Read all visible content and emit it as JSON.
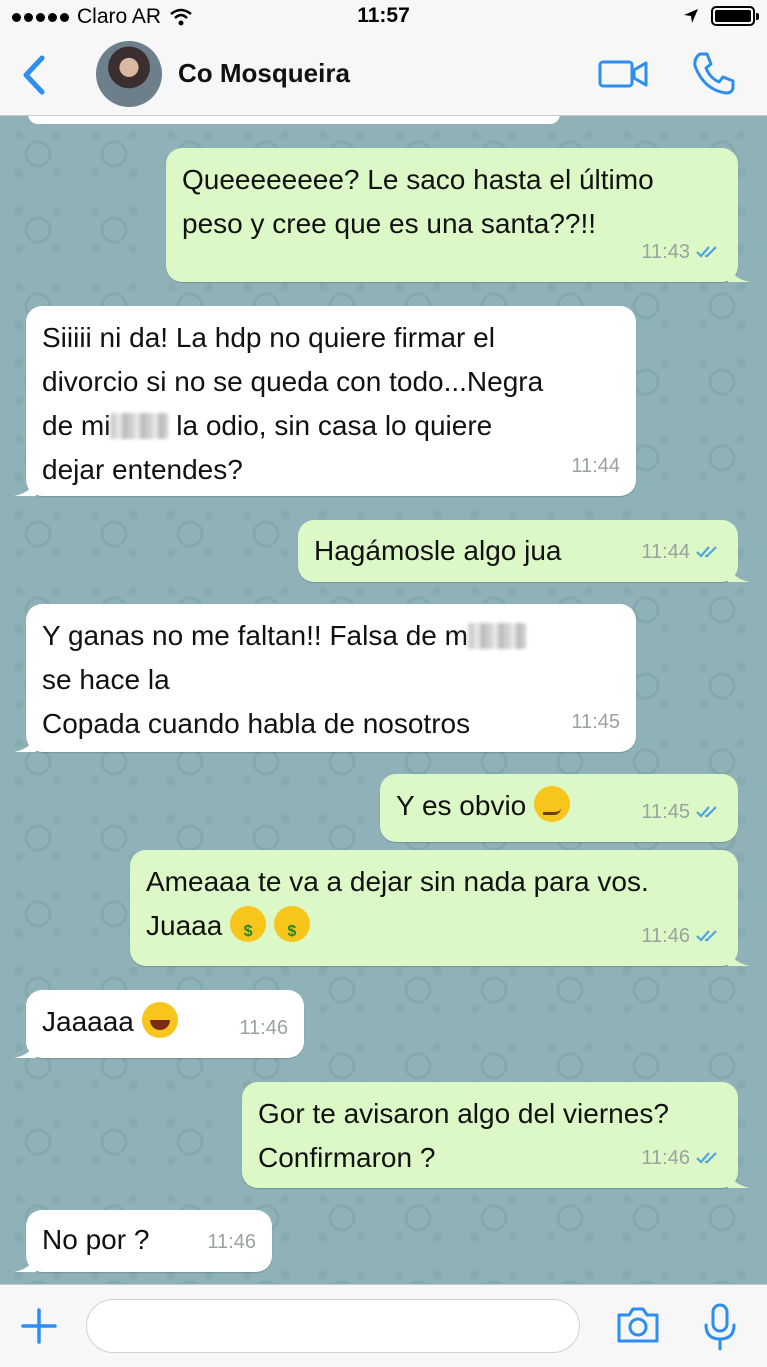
{
  "status_bar": {
    "carrier": "Claro AR",
    "time": "11:57"
  },
  "header": {
    "contact_name": "Co Mosqueira",
    "back_icon": "chevron-left-icon",
    "video_icon": "video-camera-icon",
    "call_icon": "phone-icon"
  },
  "colors": {
    "accent": "#2b8ef0",
    "outgoing_bubble": "#dcf8c6",
    "incoming_bubble": "#ffffff",
    "read_ticks": "#4fa3e0"
  },
  "messages": [
    {
      "direction": "out",
      "text_parts": [
        "Queeeeeeee? Le saco hasta el último",
        "peso y cree que es una santa??!!"
      ],
      "time": "11:43",
      "read": true
    },
    {
      "direction": "in",
      "text_parts": [
        "Siiiii ni da! La hdp no quiere firmar el",
        "divorcio si no se queda con todo...Negra",
        "de mi",
        "la odio, sin casa lo quiere",
        "dejar entendes?"
      ],
      "time": "11:44"
    },
    {
      "direction": "out",
      "text_parts": [
        "Hagámosle algo jua"
      ],
      "time": "11:44",
      "read": true
    },
    {
      "direction": "in",
      "text_parts": [
        "Y ganas no me faltan!! Falsa de m",
        "se hace la",
        "Copada cuando habla de nosotros"
      ],
      "time": "11:45"
    },
    {
      "direction": "out",
      "text_parts": [
        "Y es obvio"
      ],
      "time": "11:45",
      "read": true,
      "emoji": "smirking-face"
    },
    {
      "direction": "out",
      "text_parts": [
        "Ameaaa te va a dejar sin nada para vos.",
        "Juaaa"
      ],
      "time": "11:46",
      "read": true,
      "emoji": "money-mouth-face"
    },
    {
      "direction": "in",
      "text_parts": [
        "Jaaaaa"
      ],
      "time": "11:46",
      "emoji": "tears-of-joy-face"
    },
    {
      "direction": "out",
      "text_parts": [
        "Gor te avisaron algo del viernes?",
        "Confirmaron ?"
      ],
      "time": "11:46",
      "read": true
    },
    {
      "direction": "in",
      "text_parts": [
        "No por ?"
      ],
      "time": "11:46"
    }
  ],
  "input_bar": {
    "placeholder": "",
    "plus_icon": "plus-icon",
    "camera_icon": "camera-icon",
    "mic_icon": "microphone-icon"
  }
}
